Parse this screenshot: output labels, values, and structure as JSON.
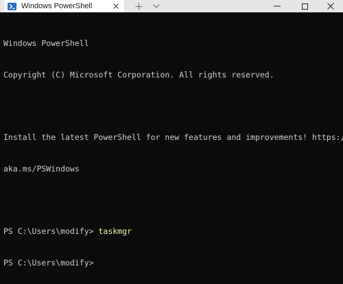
{
  "window": {
    "tab_title": "Windows PowerShell",
    "colors": {
      "background": "#0c0c0c",
      "foreground": "#cccccc",
      "command": "#f9f1a5",
      "titlebar": "#e6e6e6",
      "tab_active": "#ffffff",
      "ps_icon": "#2b6fc4"
    },
    "icons": {
      "tab_icon": "powershell-icon",
      "tab_close": "close-icon",
      "new_tab": "plus-icon",
      "dropdown": "chevron-down-icon",
      "minimize": "minimize-icon",
      "maximize": "maximize-icon",
      "close": "close-icon"
    }
  },
  "terminal": {
    "header_line1": "Windows PowerShell",
    "header_line2": "Copyright (C) Microsoft Corporation. All rights reserved.",
    "install_line1": "Install the latest PowerShell for new features and improvements! https://",
    "install_line2": "aka.ms/PSWindows",
    "prompt1": "PS C:\\Users\\modify> ",
    "command1": "taskmgr",
    "prompt2": "PS C:\\Users\\modify>"
  }
}
